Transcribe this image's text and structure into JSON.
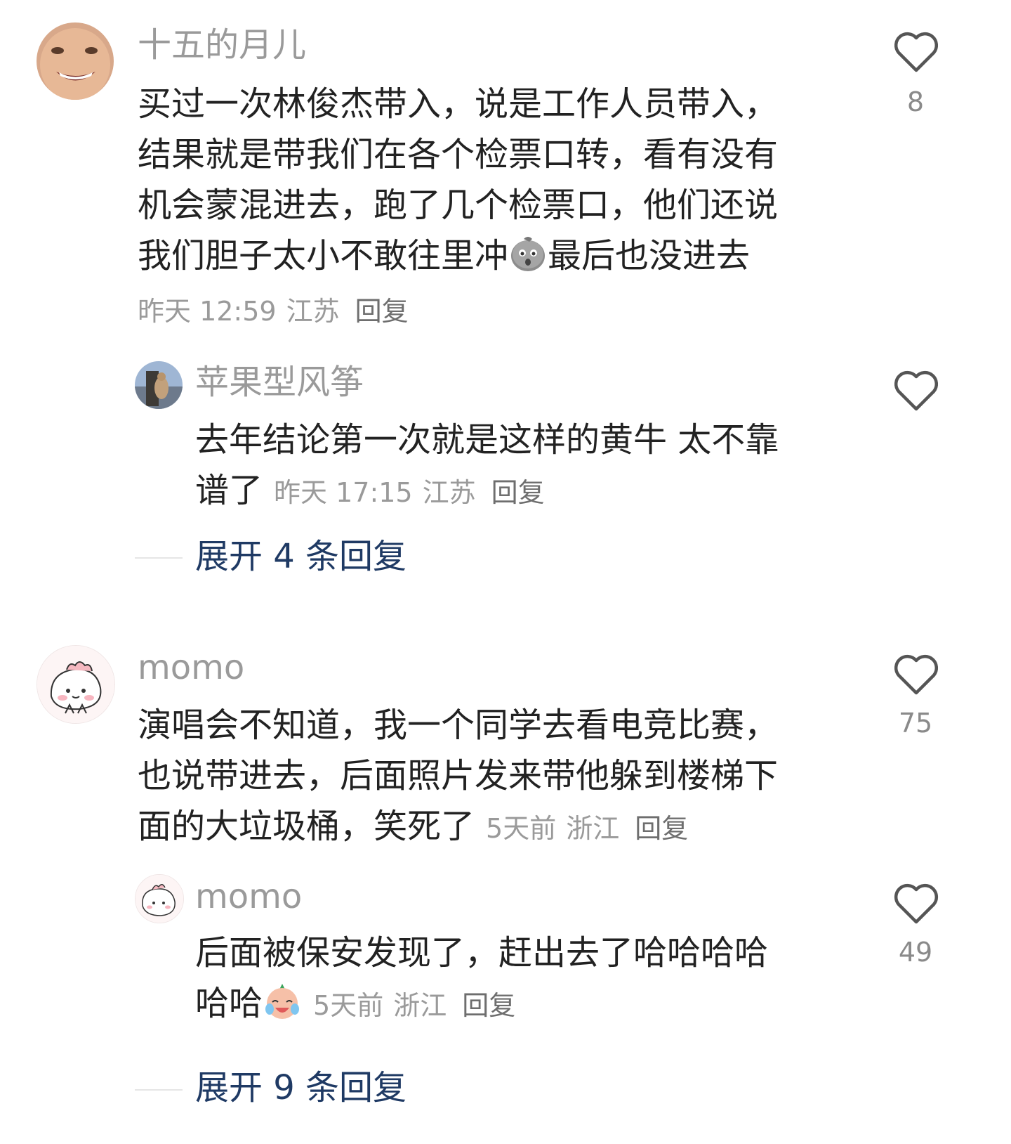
{
  "comments": [
    {
      "username": "十五的月儿",
      "content": [
        "买过一次林俊杰带入，说是工作人员带入，",
        "结果就是带我们在各个检票口转，看有没有",
        "机会蒙混进去，跑了几个检票口，他们还说",
        "我们胆子太小不敢往里冲",
        "最后也没进去"
      ],
      "time": "昨天 12:59",
      "location": "江苏",
      "reply_label": "回复",
      "likes": "8",
      "emoji": "worried-face-emoji"
    },
    {
      "username": "苹果型风筝",
      "content": [
        "去年结论第一次就是这样的黄牛 太不靠",
        "谱了"
      ],
      "time": "昨天 17:15",
      "location": "江苏",
      "reply_label": "回复",
      "likes": ""
    },
    {
      "expand": "展开 4 条回复"
    },
    {
      "username": "momo",
      "content": [
        "演唱会不知道，我一个同学去看电竞比赛，",
        "也说带进去，后面照片发来带他躲到楼梯下",
        "面的大垃圾桶，笑死了"
      ],
      "time": "5天前",
      "location": "浙江",
      "reply_label": "回复",
      "likes": "75"
    },
    {
      "username": "momo",
      "content": [
        "后面被保安发现了，赶出去了哈哈哈哈",
        "哈哈"
      ],
      "time": "5天前",
      "location": "浙江",
      "reply_label": "回复",
      "likes": "49",
      "emoji": "crying-laughing-emoji"
    },
    {
      "expand": "展开 9 条回复"
    }
  ]
}
